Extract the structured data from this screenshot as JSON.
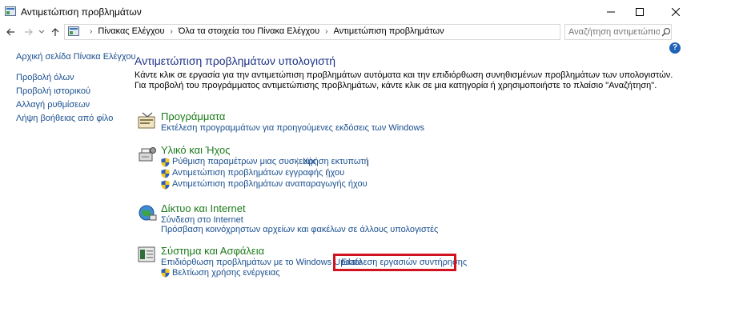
{
  "window": {
    "title": "Αντιμετώπιση προβλημάτων",
    "buttons": {
      "minimize": "—",
      "maximize": "☐",
      "close": "✕"
    }
  },
  "navigation": {
    "back_icon": "arrow-left-icon",
    "forward_icon": "arrow-right-icon",
    "up_icon": "arrow-up-icon",
    "breadcrumbs": [
      "Πίνακας Ελέγχου",
      "Όλα τα στοιχεία του Πίνακα Ελέγχου",
      "Αντιμετώπιση προβλημάτων"
    ],
    "search_placeholder": "Αναζήτηση αντιμετώπισ..."
  },
  "left_pane": {
    "home": "Αρχική σελίδα Πίνακα Ελέγχου",
    "links": [
      "Προβολή όλων",
      "Προβολή ιστορικού",
      "Αλλαγή ρυθμίσεων",
      "Λήψη βοήθειας από φίλο"
    ]
  },
  "main": {
    "title": "Αντιμετώπιση προβλημάτων υπολογιστή",
    "description": "Κάντε κλικ σε εργασία για την αντιμετώπιση προβλημάτων αυτόματα και την επιδιόρθωση συνηθισμένων προβλημάτων των υπολογιστών. Για προβολή του προγράμματος αντιμετώπισης προβλημάτων, κάντε κλικ σε μια κατηγορία ή χρησιμοποιήστε το πλαίσιο \"Αναζήτηση\".",
    "categories": [
      {
        "title": "Προγράμματα",
        "links": [
          "Εκτέλεση προγραμμάτων για προηγούμενες εκδόσεις των Windows"
        ]
      },
      {
        "title": "Υλικό και Ήχος",
        "links": [
          "Ρύθμιση παραμέτρων μιας συσκευής",
          "Χρήση εκτυπωτή",
          "Αντιμετώπιση προβλημάτων εγγραφής ήχου",
          "Αντιμετώπιση προβλημάτων αναπαραγωγής ήχου"
        ]
      },
      {
        "title": "Δίκτυο και Internet",
        "links": [
          "Σύνδεση στο Internet",
          "Πρόσβαση κοινόχρηστων αρχείων και φακέλων σε άλλους υπολογιστές"
        ]
      },
      {
        "title": "Σύστημα και Ασφάλεια",
        "links": [
          "Επιδιόρθωση προβλημάτων με το Windows Update",
          "Εκτέλεση εργασιών συντήρησης",
          "Βελτίωση χρήσης ενέργειας"
        ]
      }
    ]
  },
  "help_label": "?",
  "colors": {
    "link": "#1a4f8f",
    "category_title": "#1b7a1b",
    "page_title": "#1e3287",
    "highlight": "#d1121f"
  }
}
